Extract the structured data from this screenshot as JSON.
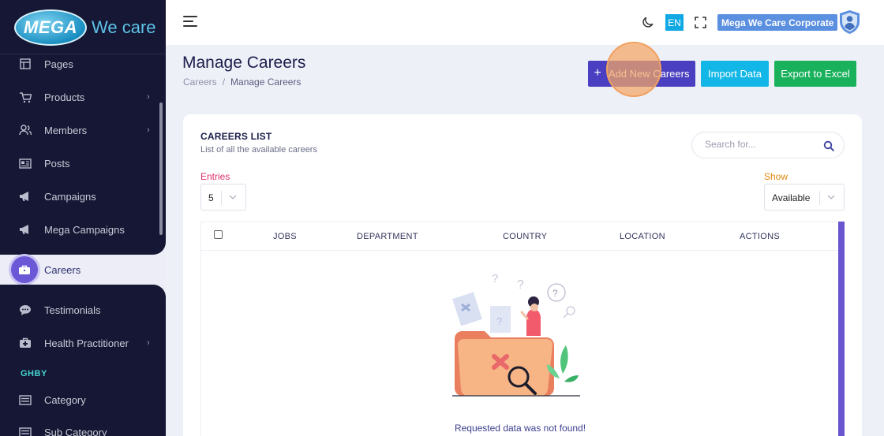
{
  "app": {
    "logo_mark": "MEGA",
    "logo_text": "We care"
  },
  "sidebar": {
    "items": [
      {
        "label": "Pages",
        "icon": "layout-icon",
        "has_children": false
      },
      {
        "label": "Products",
        "icon": "cart-icon",
        "has_children": true
      },
      {
        "label": "Members",
        "icon": "users-icon",
        "has_children": true
      },
      {
        "label": "Posts",
        "icon": "newspaper-icon",
        "has_children": false
      },
      {
        "label": "Campaigns",
        "icon": "megaphone-icon",
        "has_children": false
      },
      {
        "label": "Mega Campaigns",
        "icon": "megaphone-icon",
        "has_children": false
      },
      {
        "label": "Careers",
        "icon": "briefcase-icon",
        "has_children": false,
        "active": true
      },
      {
        "label": "Testimonials",
        "icon": "chat-icon",
        "has_children": false
      },
      {
        "label": "Health Practitioner",
        "icon": "medical-kit-icon",
        "has_children": true
      }
    ],
    "section_label": "GHBY",
    "section_items": [
      {
        "label": "Category",
        "icon": "list-icon"
      },
      {
        "label": "Sub Category",
        "icon": "list-icon"
      }
    ],
    "chevron": "›"
  },
  "header": {
    "language": "EN",
    "company": "Mega We Care Corporate"
  },
  "page": {
    "title": "Manage Careers",
    "breadcrumb": [
      "Careers",
      "Manage Careers"
    ],
    "breadcrumb_sep": "/",
    "buttons": {
      "add_icon": "+",
      "add": "Add New Careers",
      "import": "Import Data",
      "export": "Export to Excel"
    }
  },
  "card": {
    "title": "CAREERS LIST",
    "subtitle": "List of all the available careers",
    "search_placeholder": "Search for...",
    "entries_label": "Entries",
    "entries_value": "5",
    "show_label": "Show",
    "show_value": "Available",
    "columns": [
      "JOBS",
      "DEPARTMENT",
      "COUNTRY",
      "LOCATION",
      "ACTIONS"
    ],
    "empty_message": "Requested data was not found!"
  },
  "colors": {
    "sidebar_bg": "#151734",
    "accent": "#4a3fc0",
    "import": "#13b7e7",
    "export": "#19b15c",
    "entries_label": "#e0306e",
    "show_label": "#e08a10"
  }
}
